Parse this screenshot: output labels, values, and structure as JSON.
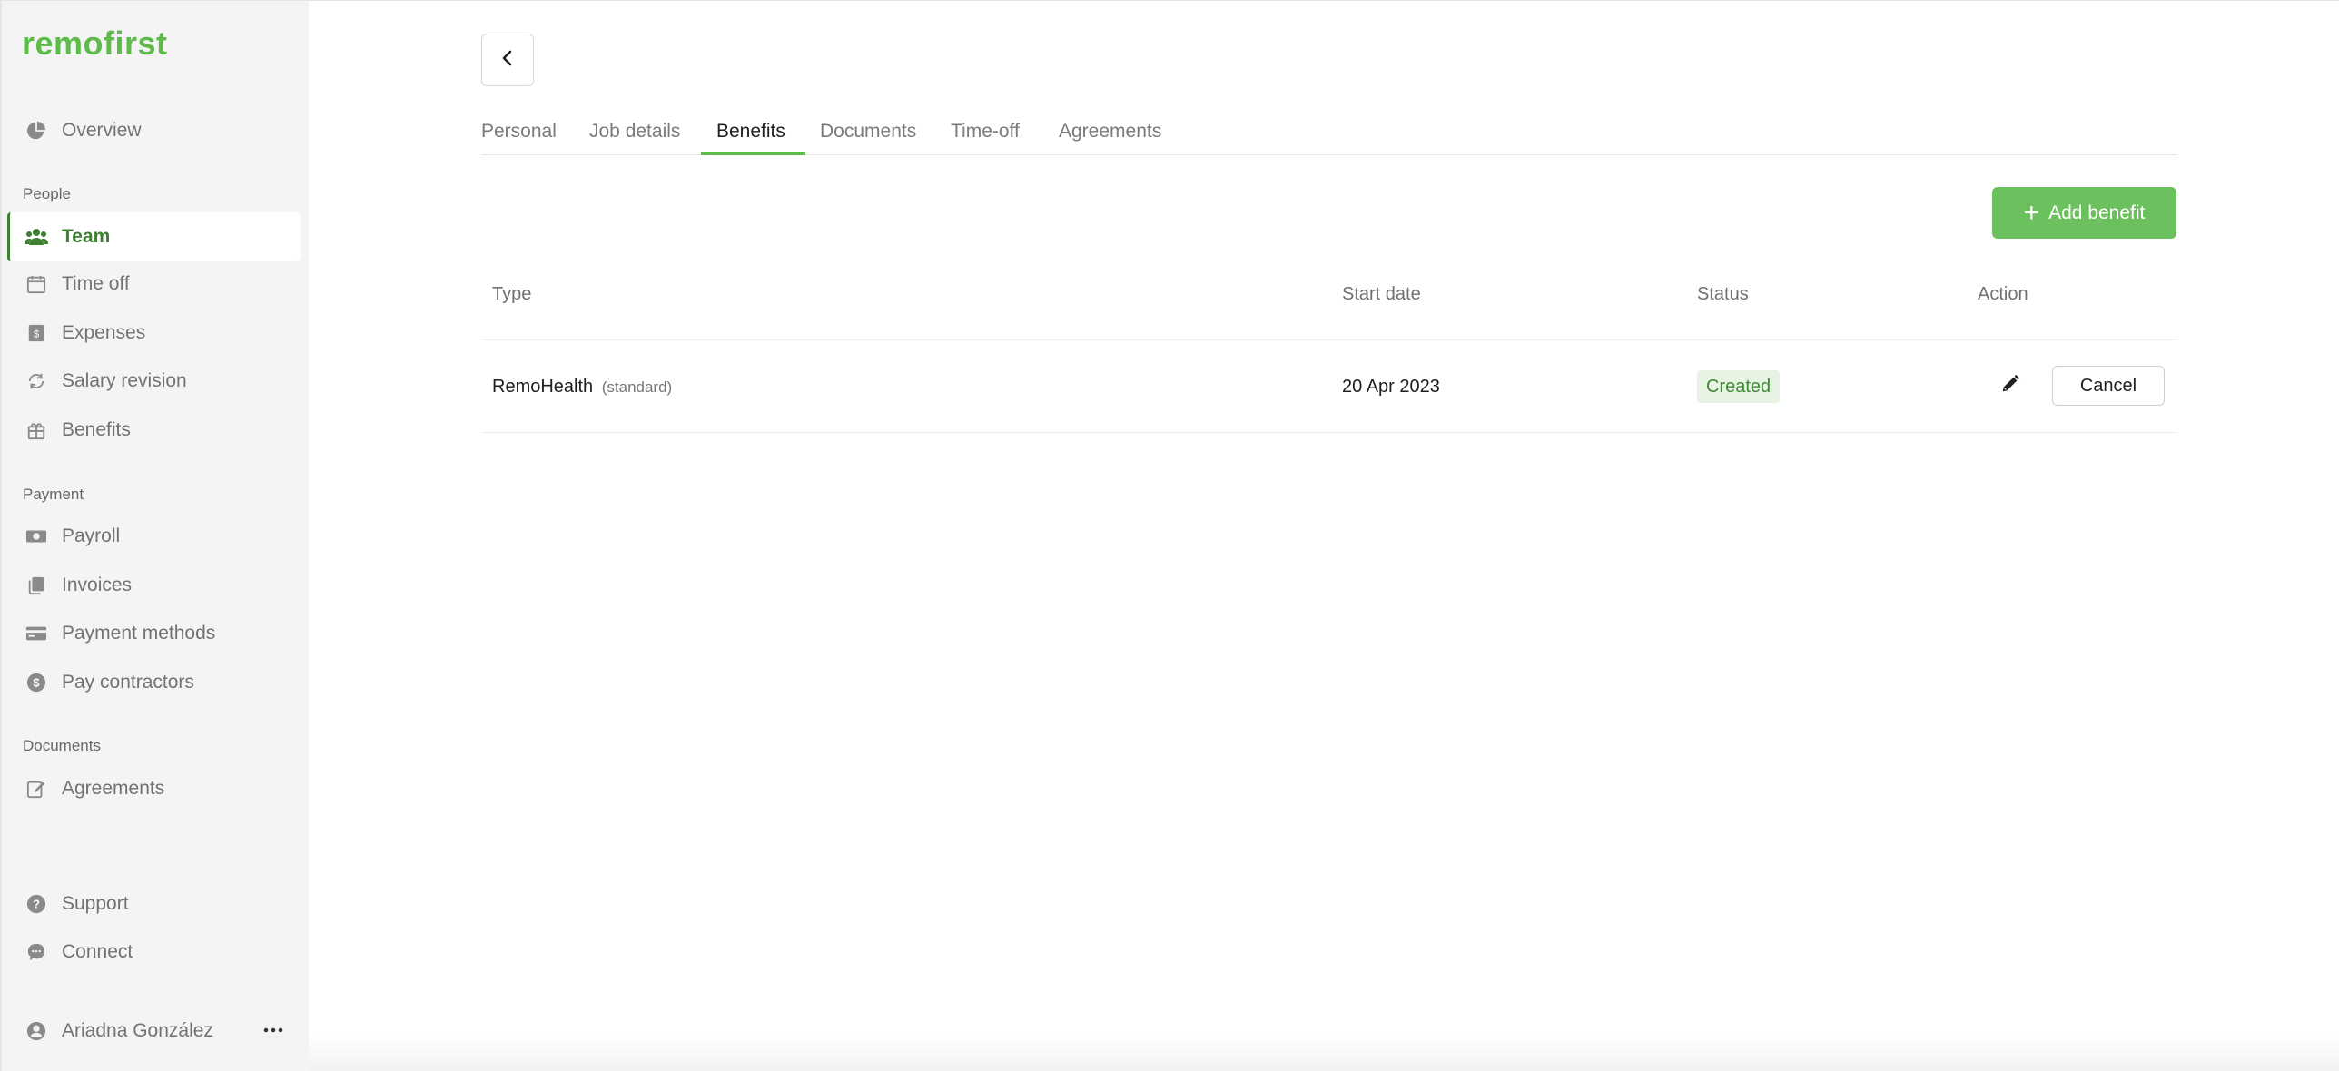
{
  "brand": {
    "logo_text": "remofirst",
    "accent": "#5dbb4a",
    "active_color": "#3f7f32"
  },
  "sidebar": {
    "overview": {
      "label": "Overview",
      "icon": "pie-chart-icon"
    },
    "section_people": "People",
    "people": [
      {
        "label": "Team",
        "icon": "team-icon",
        "active": true
      },
      {
        "label": "Time off",
        "icon": "calendar-icon"
      },
      {
        "label": "Expenses",
        "icon": "receipt-icon"
      },
      {
        "label": "Salary revision",
        "icon": "refresh-icon"
      },
      {
        "label": "Benefits",
        "icon": "gift-icon"
      }
    ],
    "section_payment": "Payment",
    "payment": [
      {
        "label": "Payroll",
        "icon": "money-icon"
      },
      {
        "label": "Invoices",
        "icon": "file-copy-icon"
      },
      {
        "label": "Payment methods",
        "icon": "credit-card-icon"
      },
      {
        "label": "Pay contractors",
        "icon": "dollar-circle-icon"
      }
    ],
    "section_documents": "Documents",
    "documents": [
      {
        "label": "Agreements",
        "icon": "edit-document-icon"
      }
    ],
    "footer": [
      {
        "label": "Support",
        "icon": "help-circle-icon"
      },
      {
        "label": "Connect",
        "icon": "chat-icon"
      }
    ],
    "user": {
      "name": "Ariadna González",
      "icon": "user-circle-icon"
    }
  },
  "tabs": [
    {
      "label": "Personal"
    },
    {
      "label": "Job details"
    },
    {
      "label": "Benefits",
      "active": true
    },
    {
      "label": "Documents"
    },
    {
      "label": "Time-off"
    },
    {
      "label": "Agreements"
    }
  ],
  "actions": {
    "add_benefit": "Add benefit"
  },
  "table": {
    "headers": {
      "type": "Type",
      "start_date": "Start date",
      "status": "Status",
      "action": "Action"
    },
    "rows": [
      {
        "type": "RemoHealth",
        "type_tag": "(standard)",
        "start_date": "20 Apr 2023",
        "status": "Created",
        "cancel_label": "Cancel"
      }
    ]
  }
}
